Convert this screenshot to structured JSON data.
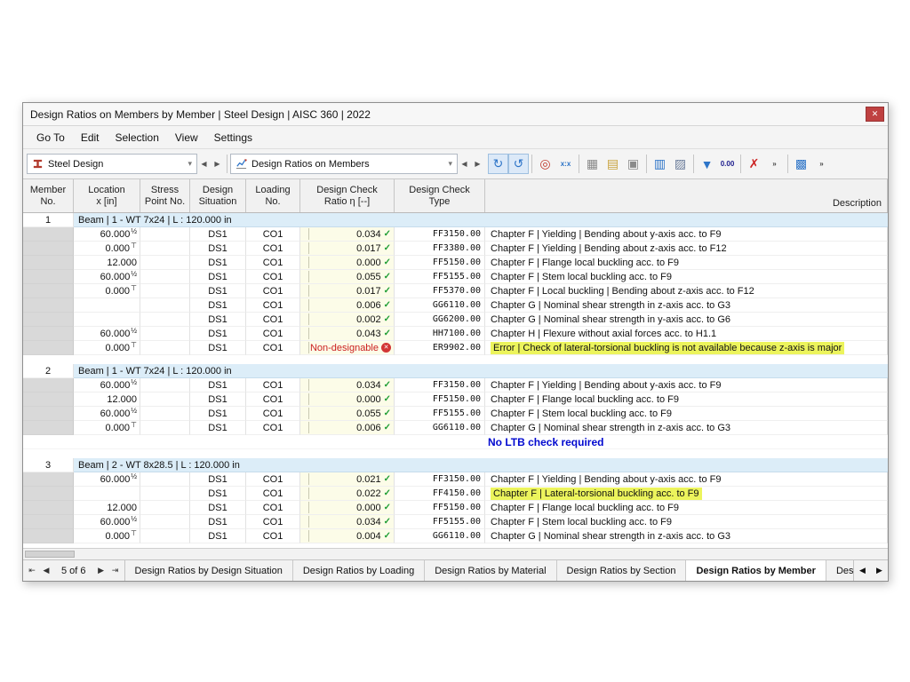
{
  "window": {
    "title": "Design Ratios on Members by Member | Steel Design | AISC 360 | 2022",
    "close_glyph": "✕"
  },
  "menu": {
    "items": [
      "Go To",
      "Edit",
      "Selection",
      "View",
      "Settings"
    ]
  },
  "toolbar": {
    "module_selector": {
      "label": "Steel Design",
      "caret": "▾"
    },
    "result_selector": {
      "label": "Design Ratios on Members",
      "caret": "▾"
    },
    "nav_prev": "◀",
    "nav_next": "▶",
    "icons": [
      {
        "name": "show-result-in-graphic-icon",
        "glyph": "↻",
        "color": "#2e75c8",
        "active": true
      },
      {
        "name": "sync-selection-icon",
        "glyph": "↺",
        "color": "#2e75c8",
        "active": true
      },
      {
        "sep": true
      },
      {
        "name": "show-location-icon",
        "glyph": "◎",
        "color": "#c0392b"
      },
      {
        "name": "result-values-icon",
        "glyph": "x:x",
        "color": "#2e75c8",
        "text": true
      },
      {
        "sep": true
      },
      {
        "name": "result-table-icon",
        "glyph": "▦",
        "color": "#8a8a8a"
      },
      {
        "name": "table-container-icon",
        "glyph": "▤",
        "color": "#c8a23c"
      },
      {
        "name": "print-icon",
        "glyph": "▣",
        "color": "#8a8a8a"
      },
      {
        "sep": true
      },
      {
        "name": "export-spreadsheet-icon",
        "glyph": "▥",
        "color": "#2e75c8"
      },
      {
        "name": "printout-report-icon",
        "glyph": "▨",
        "color": "#6a7c9a"
      },
      {
        "sep": true
      },
      {
        "name": "filter-icon",
        "glyph": "▼",
        "color": "#2e75c8"
      },
      {
        "name": "decimal-places-icon",
        "glyph": "0.00",
        "color": "#1a1a8c",
        "text": true
      },
      {
        "sep": true
      },
      {
        "name": "delete-results-icon",
        "glyph": "✗",
        "color": "#cc2222"
      },
      {
        "name": "overflow-chevron-icon",
        "glyph": "»",
        "color": "#444444",
        "text": true
      },
      {
        "sep": true
      },
      {
        "name": "table-search-icon",
        "glyph": "▩",
        "color": "#2e75c8"
      },
      {
        "name": "overflow-chevron-2-icon",
        "glyph": "»",
        "color": "#444444",
        "text": true
      }
    ]
  },
  "table": {
    "glyphs": {
      "ok": "✓",
      "error": "✕"
    },
    "columns": [
      {
        "id": "member",
        "line1": "Member",
        "line2": "No."
      },
      {
        "id": "location",
        "line1": "Location",
        "line2": "x [in]"
      },
      {
        "id": "stress_point",
        "line1": "Stress",
        "line2": "Point No."
      },
      {
        "id": "situation",
        "line1": "Design",
        "line2": "Situation"
      },
      {
        "id": "loading",
        "line1": "Loading",
        "line2": "No."
      },
      {
        "id": "ratio",
        "line1": "Design Check",
        "line2": "Ratio η [--]"
      },
      {
        "id": "type",
        "line1": "Design Check",
        "line2": "Type"
      },
      {
        "id": "description",
        "line1": "",
        "line2": "Description"
      }
    ],
    "groups": [
      {
        "member_no": "1",
        "title": "Beam | 1 - WT 7x24 | L : 120.000 in",
        "rows": [
          {
            "location": "60.000",
            "loc_mark": "½",
            "situation": "DS1",
            "loading": "CO1",
            "ratio": "0.034",
            "status": "ok",
            "type": "FF3150.00",
            "description": "Chapter F | Yielding | Bending about y-axis acc. to F9"
          },
          {
            "location": "0.000",
            "loc_mark": "⊤",
            "situation": "DS1",
            "loading": "CO1",
            "ratio": "0.017",
            "status": "ok",
            "type": "FF3380.00",
            "description": "Chapter F | Yielding | Bending about z-axis acc. to F12"
          },
          {
            "location": "12.000",
            "loc_mark": "",
            "situation": "DS1",
            "loading": "CO1",
            "ratio": "0.000",
            "status": "ok",
            "type": "FF5150.00",
            "description": "Chapter F | Flange local buckling acc. to F9"
          },
          {
            "location": "60.000",
            "loc_mark": "½",
            "situation": "DS1",
            "loading": "CO1",
            "ratio": "0.055",
            "status": "ok",
            "type": "FF5155.00",
            "description": "Chapter F | Stem local buckling acc. to F9"
          },
          {
            "location": "0.000",
            "loc_mark": "⊤",
            "situation": "DS1",
            "loading": "CO1",
            "ratio": "0.017",
            "status": "ok",
            "type": "FF5370.00",
            "description": "Chapter F | Local buckling | Bending about z-axis acc. to F12"
          },
          {
            "location": "",
            "loc_mark": "",
            "situation": "DS1",
            "loading": "CO1",
            "ratio": "0.006",
            "status": "ok",
            "type": "GG6110.00",
            "description": "Chapter G | Nominal shear strength in z-axis acc. to G3"
          },
          {
            "location": "",
            "loc_mark": "",
            "situation": "DS1",
            "loading": "CO1",
            "ratio": "0.002",
            "status": "ok",
            "type": "GG6200.00",
            "description": "Chapter G | Nominal shear strength in y-axis acc. to G6"
          },
          {
            "location": "60.000",
            "loc_mark": "½",
            "situation": "DS1",
            "loading": "CO1",
            "ratio": "0.043",
            "status": "ok",
            "type": "HH7100.00",
            "description": "Chapter H | Flexure without axial forces acc. to H1.1"
          },
          {
            "location": "0.000",
            "loc_mark": "⊤",
            "situation": "DS1",
            "loading": "CO1",
            "ratio": "Non-designable",
            "status": "error",
            "type": "ER9902.00",
            "description": "Error | Check of lateral-torsional buckling is not available because z-axis is major",
            "highlight": true
          }
        ]
      },
      {
        "member_no": "2",
        "title": "Beam | 1 - WT 7x24 | L : 120.000 in",
        "rows": [
          {
            "location": "60.000",
            "loc_mark": "½",
            "situation": "DS1",
            "loading": "CO1",
            "ratio": "0.034",
            "status": "ok",
            "type": "FF3150.00",
            "description": "Chapter F | Yielding | Bending about y-axis acc. to F9"
          },
          {
            "location": "12.000",
            "loc_mark": "",
            "situation": "DS1",
            "loading": "CO1",
            "ratio": "0.000",
            "status": "ok",
            "type": "FF5150.00",
            "description": "Chapter F | Flange local buckling acc. to F9"
          },
          {
            "location": "60.000",
            "loc_mark": "½",
            "situation": "DS1",
            "loading": "CO1",
            "ratio": "0.055",
            "status": "ok",
            "type": "FF5155.00",
            "description": "Chapter F | Stem local buckling acc. to F9"
          },
          {
            "location": "0.000",
            "loc_mark": "⊤",
            "situation": "DS1",
            "loading": "CO1",
            "ratio": "0.006",
            "status": "ok",
            "type": "GG6110.00",
            "description": "Chapter G | Nominal shear strength in z-axis acc. to G3"
          }
        ],
        "note": "No LTB check required"
      },
      {
        "member_no": "3",
        "title": "Beam | 2 - WT 8x28.5 | L : 120.000 in",
        "rows": [
          {
            "location": "60.000",
            "loc_mark": "½",
            "situation": "DS1",
            "loading": "CO1",
            "ratio": "0.021",
            "status": "ok",
            "type": "FF3150.00",
            "description": "Chapter F | Yielding | Bending about y-axis acc. to F9"
          },
          {
            "location": "",
            "loc_mark": "",
            "situation": "DS1",
            "loading": "CO1",
            "ratio": "0.022",
            "status": "ok",
            "type": "FF4150.00",
            "description": "Chapter F | Lateral-torsional buckling acc. to F9",
            "highlight": true
          },
          {
            "location": "12.000",
            "loc_mark": "",
            "situation": "DS1",
            "loading": "CO1",
            "ratio": "0.000",
            "status": "ok",
            "type": "FF5150.00",
            "description": "Chapter F | Flange local buckling acc. to F9"
          },
          {
            "location": "60.000",
            "loc_mark": "½",
            "situation": "DS1",
            "loading": "CO1",
            "ratio": "0.034",
            "status": "ok",
            "type": "FF5155.00",
            "description": "Chapter F | Stem local buckling acc. to F9"
          },
          {
            "location": "0.000",
            "loc_mark": "⊤",
            "situation": "DS1",
            "loading": "CO1",
            "ratio": "0.004",
            "status": "ok",
            "type": "GG6110.00",
            "description": "Chapter G | Nominal shear strength in z-axis acc. to G3"
          }
        ]
      }
    ]
  },
  "footer": {
    "pager": {
      "first": "⇤",
      "prev": "◀",
      "label": "5 of 6",
      "next": "▶",
      "last": "⇥"
    },
    "tabs": [
      "Design Ratios by Design Situation",
      "Design Ratios by Loading",
      "Design Ratios by Material",
      "Design Ratios by Section",
      "Design Ratios by Member",
      "Design"
    ],
    "active_tab": "Design Ratios by Member",
    "scroll_left": "◀",
    "scroll_right": "▶"
  }
}
